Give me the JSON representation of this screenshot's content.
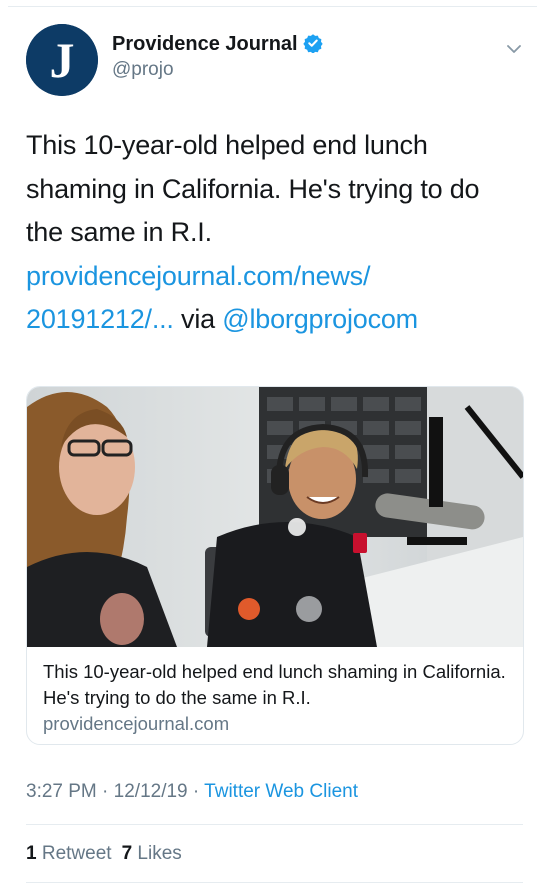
{
  "account": {
    "display_name": "Providence Journal",
    "handle": "@projo",
    "verified": true,
    "avatar_letter": "J"
  },
  "tweet": {
    "line1": "This 10-year-old helped end lunch",
    "line2": "shaming in California. He's trying to do",
    "line3": "the same in R.I.",
    "link_line1": "providencejournal.com/news/",
    "link_line2": "20191212/...",
    "via": " via ",
    "mention": "@lborgprojocom"
  },
  "card": {
    "title": "This 10-year-old helped end lunch shaming in California. He's trying to do the same in R.I.",
    "domain": "providencejournal.com"
  },
  "meta": {
    "time": "3:27 PM",
    "separator": " · ",
    "date": "12/12/19",
    "source": "Twitter Web Client"
  },
  "stats": {
    "retweets_count": "1",
    "retweets_label": "Retweet",
    "likes_count": "7",
    "likes_label": "Likes"
  },
  "colors": {
    "link": "#1b95e0",
    "secondary_text": "#657786",
    "primary_text": "#14171a",
    "avatar_bg": "#0d3b66",
    "verified": "#1da1f2"
  },
  "icons": [
    "verified-badge-icon",
    "chevron-down-icon"
  ]
}
